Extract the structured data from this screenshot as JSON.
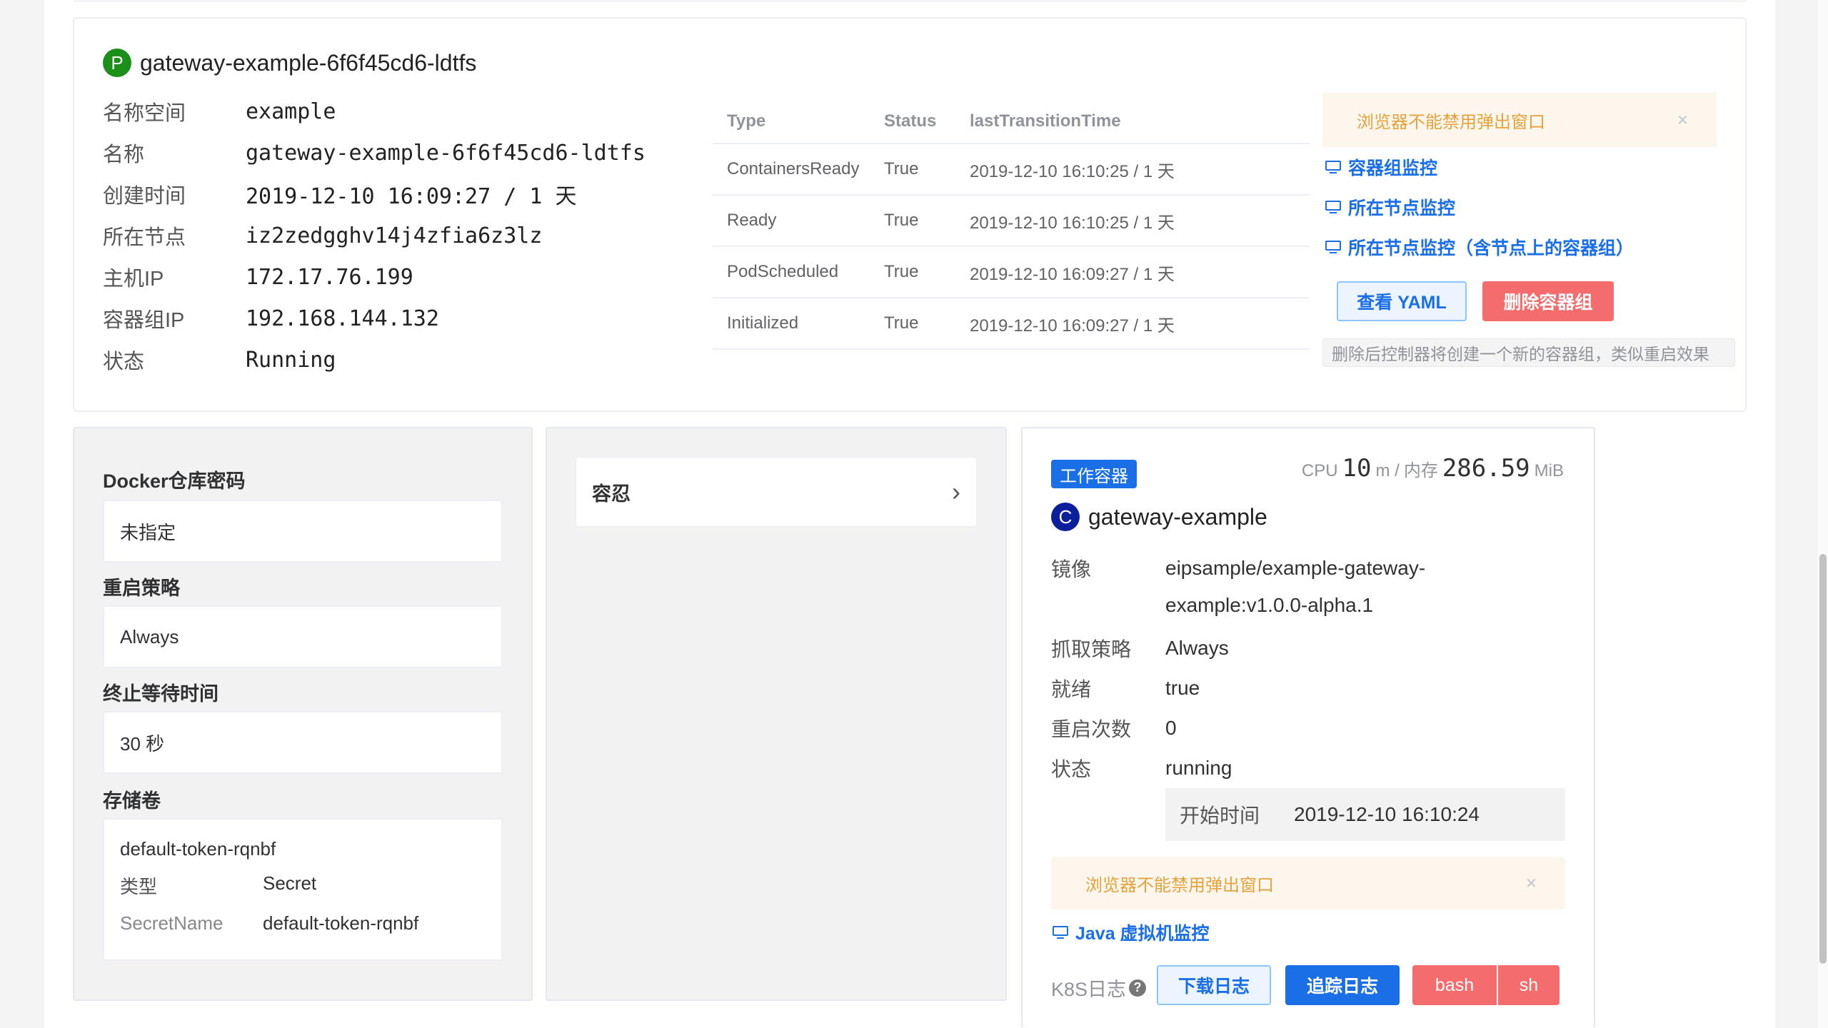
{
  "pod": {
    "status_badge": "P",
    "title": "gateway-example-6f6f45cd6-ldtfs",
    "fields": [
      {
        "key": "名称空间",
        "value": "example"
      },
      {
        "key": "名称",
        "value": "gateway-example-6f6f45cd6-ldtfs"
      },
      {
        "key": "创建时间",
        "value": "2019-12-10 16:09:27 / 1 天"
      },
      {
        "key": "所在节点",
        "value": "iz2zedgghv14j4zfia6z3lz"
      },
      {
        "key": "主机IP",
        "value": "172.17.76.199"
      },
      {
        "key": "容器组IP",
        "value": "192.168.144.132"
      },
      {
        "key": "状态",
        "value": "Running"
      }
    ]
  },
  "conditions": {
    "headers": [
      "Type",
      "Status",
      "lastTransitionTime"
    ],
    "rows": [
      {
        "type": "ContainersReady",
        "status": "True",
        "time": "2019-12-10 16:10:25 / 1 天"
      },
      {
        "type": "Ready",
        "status": "True",
        "time": "2019-12-10 16:10:25 / 1 天"
      },
      {
        "type": "PodScheduled",
        "status": "True",
        "time": "2019-12-10 16:09:27 / 1 天"
      },
      {
        "type": "Initialized",
        "status": "True",
        "time": "2019-12-10 16:09:27 / 1 天"
      }
    ]
  },
  "side": {
    "alert": "浏览器不能禁用弹出窗口",
    "links": [
      "容器组监控",
      "所在节点监控",
      "所在节点监控（含节点上的容器组）"
    ],
    "yaml_button": "查看 YAML",
    "delete_button": "删除容器组",
    "delete_hint": "删除后控制器将创建一个新的容器组，类似重启效果"
  },
  "spec": {
    "docker_secret_label": "Docker仓库密码",
    "docker_secret_value": "未指定",
    "restart_label": "重启策略",
    "restart_value": "Always",
    "grace_label": "终止等待时间",
    "grace_value": "30 秒",
    "volumes_label": "存储卷",
    "volume": {
      "name": "default-token-rqnbf",
      "type_key": "类型",
      "type_value": "Secret",
      "secret_key": "SecretName",
      "secret_value": "default-token-rqnbf"
    }
  },
  "tolerations": {
    "label": "容忍",
    "chevron": "›"
  },
  "container": {
    "tag": "工作容器",
    "cpu_label": "CPU",
    "cpu_value": "10",
    "cpu_unit": "m /",
    "mem_label": "内存",
    "mem_value": "286.59",
    "mem_unit": "MiB",
    "badge": "C",
    "name": "gateway-example",
    "image_key": "镜像",
    "image_line1": "eipsample/example-gateway-",
    "image_line2": "example:v1.0.0-alpha.1",
    "pull_key": "抓取策略",
    "pull_value": "Always",
    "ready_key": "就绪",
    "ready_value": "true",
    "restart_key": "重启次数",
    "restart_value": "0",
    "state_key": "状态",
    "state_value": "running",
    "start_key": "开始时间",
    "start_value": "2019-12-10 16:10:24",
    "alert": "浏览器不能禁用弹出窗口",
    "jvm_link": "Java 虚拟机监控",
    "k8s_label": "K8S日志",
    "qmark": "?",
    "download_button": "下载日志",
    "trace_button": "追踪日志",
    "bash_button": "bash",
    "sh_button": "sh",
    "close_glyph": "×"
  }
}
